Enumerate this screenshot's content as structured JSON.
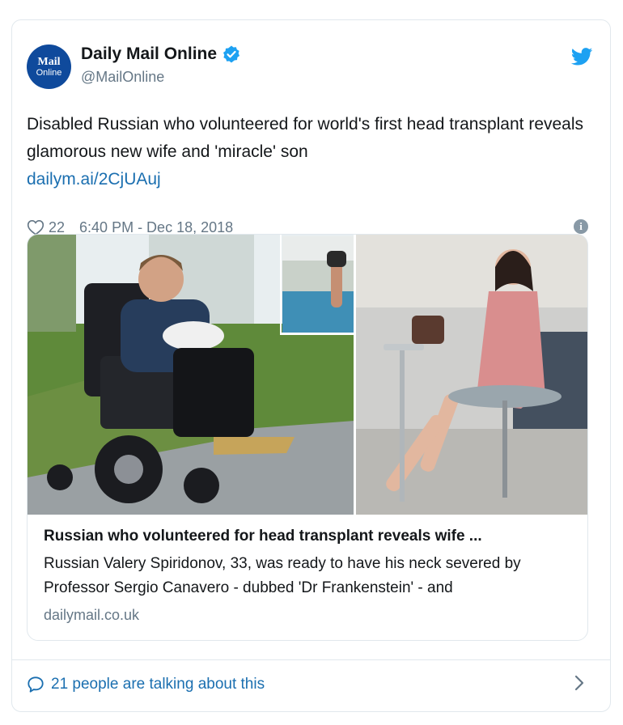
{
  "author": {
    "avatar_line1": "Mail",
    "avatar_line2": "Online",
    "display_name": "Daily Mail Online",
    "handle": "@MailOnline",
    "verified": true
  },
  "tweet": {
    "text": "Disabled Russian who volunteered for world's first head transplant reveals glamorous new wife and 'miracle' son",
    "link": "dailym.ai/2CjUAuj",
    "likes": "22",
    "timestamp": "6:40 PM - Dec 18, 2018"
  },
  "link_card": {
    "title": "Russian who volunteered for head transplant reveals wife ...",
    "description": "Russian Valery Spiridonov, 33, was ready to have his neck severed by Professor Sergio Canavero - dubbed 'Dr Frankenstein' - and",
    "domain": "dailymail.co.uk"
  },
  "footer": {
    "talking": "21 people are talking about this"
  },
  "colors": {
    "link": "#1b6fb0",
    "secondary_text": "#657786",
    "border": "#e1e8ed",
    "verified": "#1da1f2",
    "brand_avatar": "#0f4a9c"
  },
  "icons": [
    "twitter-bird-icon",
    "verified-badge-icon",
    "heart-icon",
    "info-icon",
    "speech-bubble-icon",
    "chevron-right-icon"
  ]
}
